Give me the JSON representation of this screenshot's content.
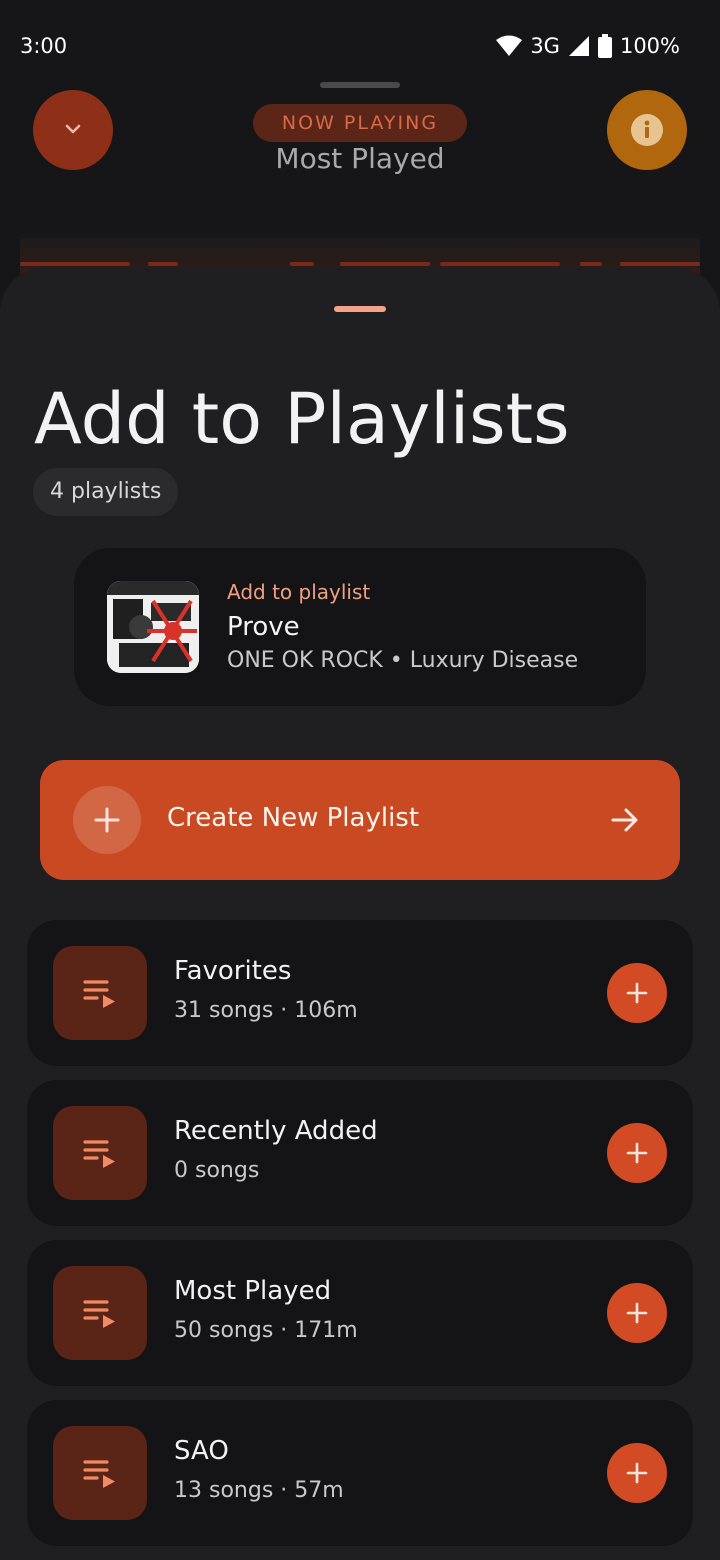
{
  "status_bar": {
    "time": "3:00",
    "network": "3G",
    "battery": "100%"
  },
  "player": {
    "badge": "NOW PLAYING",
    "title": "Most Played"
  },
  "sheet": {
    "title": "Add to Playlists",
    "count": "4 playlists",
    "song_card": {
      "kicker": "Add to playlist",
      "title": "Prove",
      "subtitle": "ONE OK ROCK • Luxury Disease"
    },
    "create_button": {
      "label": "Create New Playlist"
    },
    "playlists": [
      {
        "name": "Favorites",
        "meta": "31 songs · 106m"
      },
      {
        "name": "Recently Added",
        "meta": "0 songs"
      },
      {
        "name": "Most Played",
        "meta": "50 songs · 171m"
      },
      {
        "name": "SAO",
        "meta": "13 songs · 57m"
      }
    ]
  },
  "colors": {
    "accent": "#c94a22",
    "sheet_bg": "#1f1f22",
    "card_bg": "#141416",
    "icon_bg": "#5a2516",
    "kicker": "#f0a081"
  },
  "icons": [
    "chevron-down-icon",
    "info-icon",
    "wifi-icon",
    "signal-icon",
    "battery-icon",
    "plus-icon",
    "arrow-right-icon",
    "playlist-icon"
  ]
}
